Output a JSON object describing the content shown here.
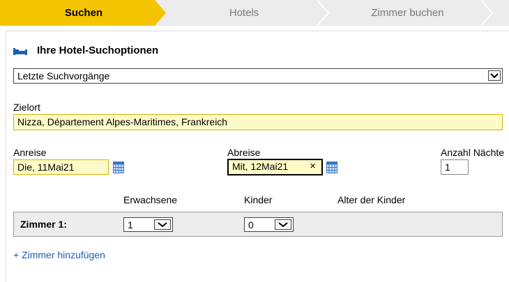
{
  "steps": [
    {
      "label": "Suchen",
      "active": true
    },
    {
      "label": "Hotels",
      "active": false
    },
    {
      "label": "Zimmer buchen",
      "active": false
    }
  ],
  "colors": {
    "accent": "#f5c400",
    "link": "#1a5fb4",
    "field_bg": "#fffbc8",
    "field_border": "#d9b000"
  },
  "search": {
    "heading": "Ihre Hotel-Suchoptionen",
    "recent_select": "Letzte Suchvorgänge",
    "destination_label": "Zielort",
    "destination_value": "Nizza, Département Alpes-Maritimes, Frankreich",
    "checkin_label": "Anreise",
    "checkin_value": "Die, 11Mai21",
    "checkout_label": "Abreise",
    "checkout_value": "Mit, 12Mai21",
    "nights_label": "Anzahl Nächte",
    "nights_value": "1"
  },
  "rooms": {
    "adults_label": "Erwachsene",
    "children_label": "Kinder",
    "child_ages_label": "Alter der Kinder",
    "room_label": "Zimmer 1:",
    "adults_value": "1",
    "children_value": "0",
    "add_room_link": "+ Zimmer hinzufügen"
  },
  "icons": {
    "clear": "×",
    "bed": "bed-icon",
    "calendar": "calendar-icon",
    "chevron": "chevron-down-icon"
  }
}
